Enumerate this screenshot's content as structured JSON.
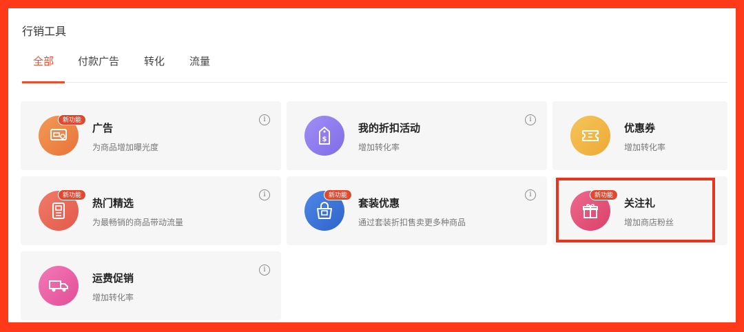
{
  "page": {
    "title": "行销工具"
  },
  "tabs": [
    {
      "label": "全部",
      "active": true
    },
    {
      "label": "付款广告",
      "active": false
    },
    {
      "label": "转化",
      "active": false
    },
    {
      "label": "流量",
      "active": false
    }
  ],
  "colors": {
    "accent": "#ee4d2d",
    "frame_border": "#ff3a1a",
    "highlight_box": "#e8341c"
  },
  "info_glyph": "i",
  "tools": [
    {
      "title": "广告",
      "desc": "为商品增加曝光度",
      "badge": "新功能",
      "icon": "ad-icon",
      "color": "#ee8440"
    },
    {
      "title": "我的折扣活动",
      "desc": "增加转化率",
      "badge": "",
      "icon": "discount-tag-icon",
      "color": "#8d7cf0"
    },
    {
      "title": "优惠券",
      "desc": "增加转化率",
      "badge": "",
      "icon": "coupon-icon",
      "color": "#f0b444"
    },
    {
      "title": "热门精选",
      "desc": "为最畅销的商品带动流量",
      "badge": "新功能",
      "icon": "document-icon",
      "color": "#ea6a5a"
    },
    {
      "title": "套装优惠",
      "desc": "通过套装折扣售卖更多种商品",
      "badge": "新功能",
      "icon": "bundle-bag-icon",
      "color": "#3d75d8"
    },
    {
      "title": "关注礼",
      "desc": "增加商店粉丝",
      "badge": "新功能",
      "icon": "gift-icon",
      "color": "#e5517a",
      "highlighted": true
    },
    {
      "title": "运费促销",
      "desc": "增加转化率",
      "badge": "",
      "icon": "truck-icon",
      "color": "#ec5da2"
    }
  ]
}
